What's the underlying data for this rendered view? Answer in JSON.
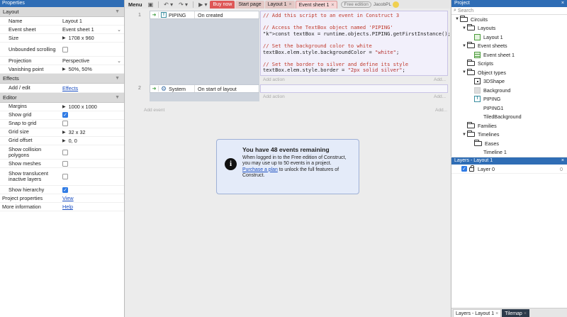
{
  "properties": {
    "title": "Properties",
    "sections": {
      "layout": "Layout",
      "effects": "Effects",
      "editor": "Editor"
    },
    "layout_rows": [
      {
        "label": "Name",
        "value": "Layout 1"
      },
      {
        "label": "Event sheet",
        "value": "Event sheet 1"
      },
      {
        "label": "Size",
        "value": "1708 x 960"
      },
      {
        "label": "Unbounded scrolling",
        "checked": false
      },
      {
        "label": "Projection",
        "value": "Perspective"
      },
      {
        "label": "Vanishing point",
        "value": "50%, 50%"
      }
    ],
    "effects_rows": [
      {
        "label": "Add / edit",
        "link": "Effects"
      }
    ],
    "editor_rows": [
      {
        "label": "Margins",
        "value": "1000 x 1000"
      },
      {
        "label": "Show grid",
        "checked": true
      },
      {
        "label": "Snap to grid",
        "checked": false
      },
      {
        "label": "Grid size",
        "value": "32 x 32"
      },
      {
        "label": "Grid offset",
        "value": "0, 0"
      },
      {
        "label": "Show collision polygons",
        "checked": false
      },
      {
        "label": "Show meshes",
        "checked": false
      },
      {
        "label": "Show translucent inactive layers",
        "checked": false
      },
      {
        "label": "Show hierarchy",
        "checked": true
      }
    ],
    "footer_rows": [
      {
        "label": "Project properties",
        "link": "View"
      },
      {
        "label": "More information",
        "link": "Help"
      }
    ]
  },
  "toolbar": {
    "menu_label": "Menu",
    "tabs": {
      "buy": "Buy now",
      "start": "Start page",
      "layout": "Layout 1",
      "sheet": "Event sheet 1"
    },
    "free_badge": "Free edition",
    "username": "JacobPL"
  },
  "events": [
    {
      "number": "1",
      "object": "PIPING",
      "condition": "On created",
      "code_lines": [
        {
          "type": "comment",
          "text": "// Add this script to an event in Construct 3"
        },
        {
          "type": "blank",
          "text": ""
        },
        {
          "type": "comment",
          "text": "// Access the TextBox object named 'PIPING'"
        },
        {
          "type": "code",
          "text": "const textBox = runtime.objects.PIPING.getFirstInstance();"
        },
        {
          "type": "blank",
          "text": ""
        },
        {
          "type": "comment",
          "text": "// Set the background color to white"
        },
        {
          "type": "code",
          "text": "textBox.elem.style.backgroundColor = \"white\";"
        },
        {
          "type": "blank",
          "text": ""
        },
        {
          "type": "comment",
          "text": "// Set the border to silver and define its style"
        },
        {
          "type": "code",
          "text": "textBox.elem.style.border = \"2px solid silver\";"
        }
      ],
      "add_action": "Add action",
      "add_more": "Add..."
    },
    {
      "number": "2",
      "object": "System",
      "condition": "On start of layout",
      "add_action": "Add action",
      "add_more": "Add..."
    }
  ],
  "add_event": "Add event",
  "add_event_more": "Add...",
  "notice": {
    "title": "You have 48 events remaining",
    "body_before": "When logged in to the Free edition of Construct, you may use up to 50 events in a project. ",
    "link": "Purchase a plan",
    "body_after": " to unlock the full features of Construct."
  },
  "project": {
    "title": "Project",
    "search_placeholder": "Search",
    "tree": [
      {
        "label": "Circuits",
        "level": 0,
        "icon": "folder",
        "twisty": "▼"
      },
      {
        "label": "Layouts",
        "level": 1,
        "icon": "folder",
        "twisty": "▼"
      },
      {
        "label": "Layout 1",
        "level": 2,
        "icon": "layout"
      },
      {
        "label": "Event sheets",
        "level": 1,
        "icon": "folder",
        "twisty": "▼"
      },
      {
        "label": "Event sheet 1",
        "level": 2,
        "icon": "sheet"
      },
      {
        "label": "Scripts",
        "level": 1,
        "icon": "folder"
      },
      {
        "label": "Object types",
        "level": 1,
        "icon": "folder",
        "twisty": "▼"
      },
      {
        "label": "3DShape",
        "level": 2,
        "icon": "shape3d"
      },
      {
        "label": "Background",
        "level": 2,
        "icon": "bg"
      },
      {
        "label": "PIPING",
        "level": 2,
        "icon": "piping"
      },
      {
        "label": "PIPING1",
        "level": 2,
        "icon": "blank"
      },
      {
        "label": "TiledBackground",
        "level": 2,
        "icon": "blank"
      },
      {
        "label": "Families",
        "level": 1,
        "icon": "folder"
      },
      {
        "label": "Timelines",
        "level": 1,
        "icon": "folder",
        "twisty": "▼"
      },
      {
        "label": "Eases",
        "level": 2,
        "icon": "folder"
      },
      {
        "label": "Timeline 1",
        "level": 2,
        "icon": "blank"
      }
    ]
  },
  "layers": {
    "title": "Layers - Layout 1",
    "rows": [
      {
        "label": "Layer 0",
        "count": "0",
        "visible": true
      }
    ]
  },
  "bottom_tabs": {
    "layers": "Layers - Layout 1",
    "tilemap": "Tilemap"
  }
}
